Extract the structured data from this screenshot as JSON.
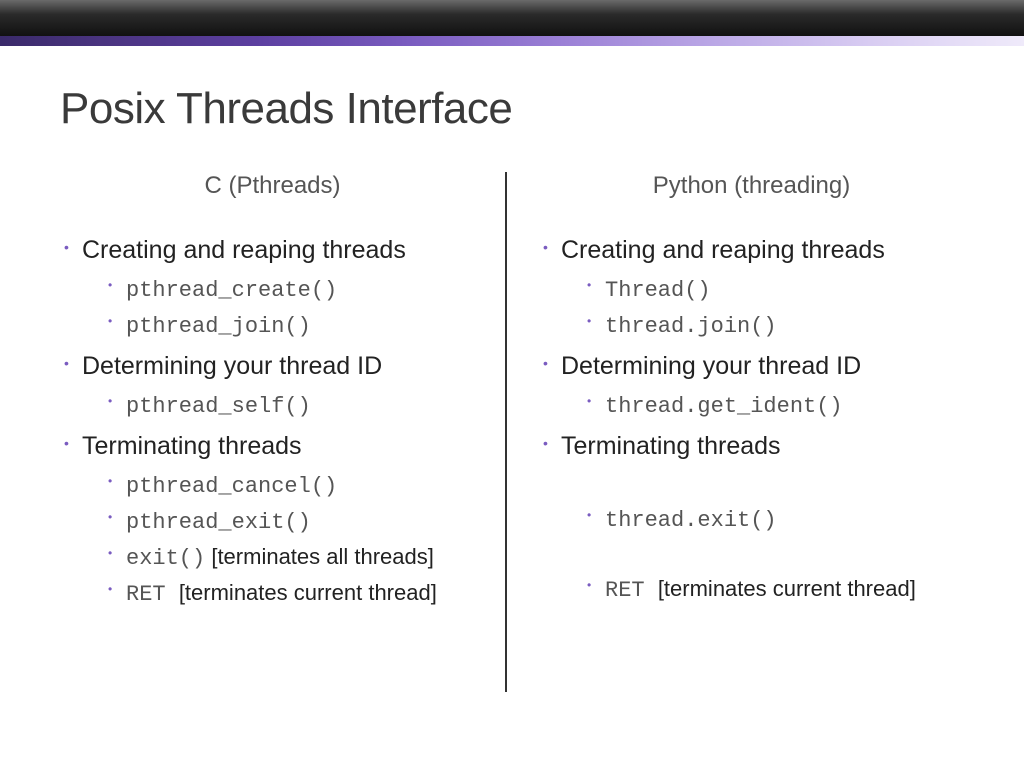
{
  "slide": {
    "title": "Posix Threads Interface",
    "left": {
      "heading": "C (Pthreads)",
      "sections": [
        {
          "title": "Creating and reaping threads",
          "items": [
            {
              "code": "pthread_create()",
              "note": ""
            },
            {
              "code": "pthread_join()",
              "note": ""
            }
          ]
        },
        {
          "title": "Determining your thread ID",
          "items": [
            {
              "code": "pthread_self()",
              "note": ""
            }
          ]
        },
        {
          "title": "Terminating threads",
          "items": [
            {
              "code": "pthread_cancel()",
              "note": ""
            },
            {
              "code": "pthread_exit()",
              "note": ""
            },
            {
              "code": "exit()",
              "note": " [terminates all threads]"
            },
            {
              "code": "RET ",
              "note": " [terminates current thread]"
            }
          ]
        }
      ]
    },
    "right": {
      "heading": "Python (threading)",
      "sections": [
        {
          "title": "Creating and reaping threads",
          "items": [
            {
              "code": "Thread()",
              "note": ""
            },
            {
              "code": "thread.join()",
              "note": ""
            }
          ]
        },
        {
          "title": "Determining your thread ID",
          "items": [
            {
              "code": "thread.get_ident()",
              "note": ""
            }
          ]
        },
        {
          "title": "Terminating threads",
          "items": [
            {
              "code": ".",
              "note": "",
              "blank": true
            },
            {
              "code": "thread.exit()",
              "note": ""
            },
            {
              "code": ".",
              "note": "",
              "blank": true
            },
            {
              "code": "RET ",
              "note": " [terminates current thread]"
            }
          ]
        }
      ]
    }
  }
}
